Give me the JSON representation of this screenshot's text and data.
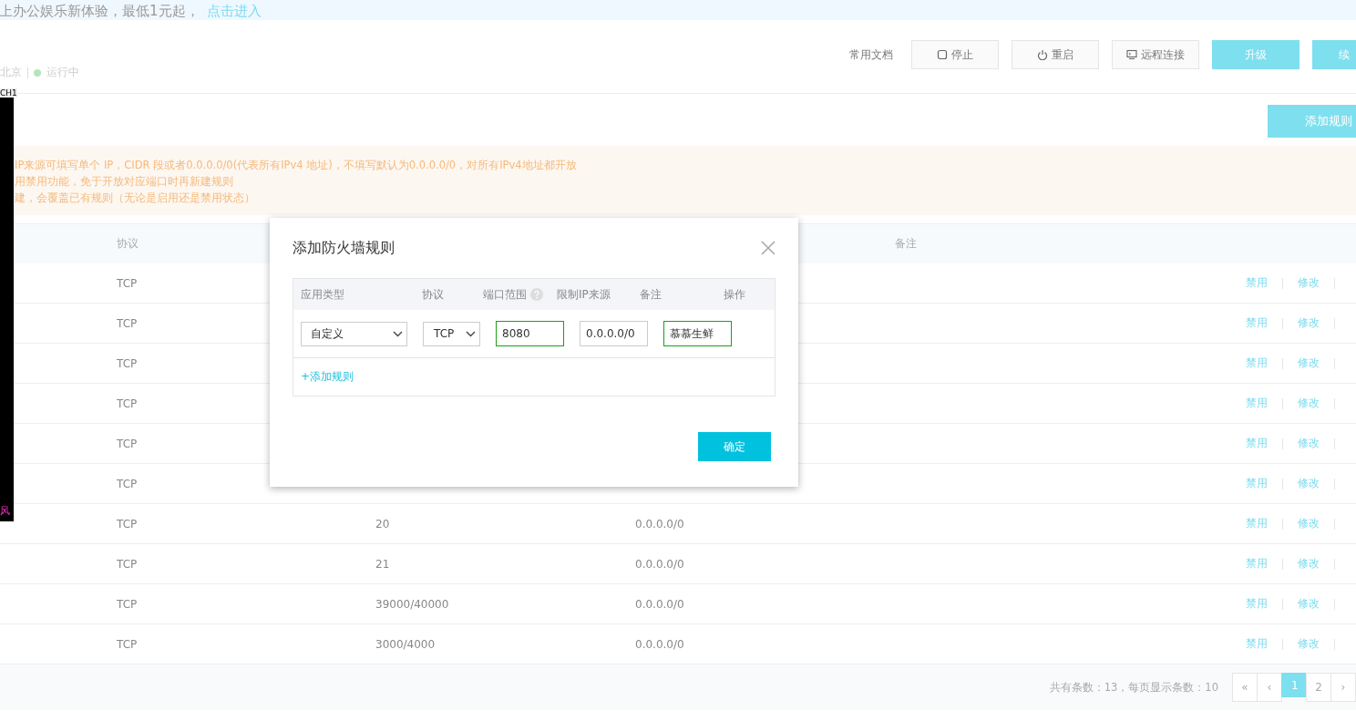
{
  "banner": {
    "text": "上办公娱乐新体验，最低1元起，",
    "link": "点击进入"
  },
  "instance": {
    "region": "北京",
    "status": "运行中",
    "running": true
  },
  "toolbar": {
    "docs_link": "常用文档",
    "buttons": [
      {
        "label": "停止",
        "kind": "stop"
      },
      {
        "label": "重启",
        "kind": "restart"
      },
      {
        "label": "远程连接",
        "kind": "remote"
      },
      {
        "label": "升级",
        "kind": "primary"
      },
      {
        "label": "续",
        "kind": "primary"
      }
    ]
  },
  "overlay_strip": {
    "top_label": "CH1",
    "bottom_label": "风"
  },
  "add_rule_button": "添加规则",
  "notices": [
    "IP来源可填写单个 IP，CIDR 段或者0.0.0.0/0(代表所有IPv4 地址)，不填写默认为0.0.0.0/0，对所有IPv4地址都开放",
    "用禁用功能，免于开放对应端口时再新建规则",
    "建，会覆盖已有规则（无论是启用还是禁用状态）"
  ],
  "table": {
    "columns": [
      "协议",
      "备注"
    ],
    "rows": [
      {
        "protocol": "TCP",
        "actions": [
          "禁用",
          "修改"
        ]
      },
      {
        "protocol": "TCP",
        "actions": [
          "禁用",
          "修改"
        ]
      },
      {
        "protocol": "TCP",
        "actions": [
          "禁用",
          "修改"
        ]
      },
      {
        "protocol": "TCP",
        "actions": [
          "禁用",
          "修改"
        ]
      },
      {
        "protocol": "TCP",
        "actions": [
          "禁用",
          "修改"
        ]
      },
      {
        "protocol": "TCP",
        "actions": [
          "禁用",
          "修改"
        ]
      },
      {
        "protocol": "TCP",
        "port": "20",
        "source": "0.0.0.0/0",
        "actions": [
          "禁用",
          "修改"
        ]
      },
      {
        "protocol": "TCP",
        "port": "21",
        "source": "0.0.0.0/0",
        "actions": [
          "禁用",
          "修改"
        ]
      },
      {
        "protocol": "TCP",
        "port": "39000/40000",
        "source": "0.0.0.0/0",
        "actions": [
          "禁用",
          "修改"
        ]
      },
      {
        "protocol": "TCP",
        "port": "3000/4000",
        "source": "0.0.0.0/0",
        "actions": [
          "禁用",
          "修改"
        ]
      }
    ]
  },
  "pagination": {
    "summary": "共有条数：13，每页显示条数：10",
    "controls": [
      {
        "label": "«",
        "selected": false
      },
      {
        "label": "‹",
        "selected": false
      },
      {
        "label": "1",
        "selected": true
      },
      {
        "label": "2",
        "selected": false
      },
      {
        "label": "›",
        "selected": false
      }
    ]
  },
  "dialog": {
    "title": "添加防火墙规则",
    "columns": [
      "应用类型",
      "协议",
      "端口范围",
      "限制IP来源",
      "备注",
      "操作"
    ],
    "row": {
      "app_type": "自定义",
      "protocol": "TCP",
      "port": "8080",
      "source": "0.0.0.0/0",
      "note": "慕慕生鲜"
    },
    "add_link": "+添加规则",
    "confirm": "确定"
  }
}
